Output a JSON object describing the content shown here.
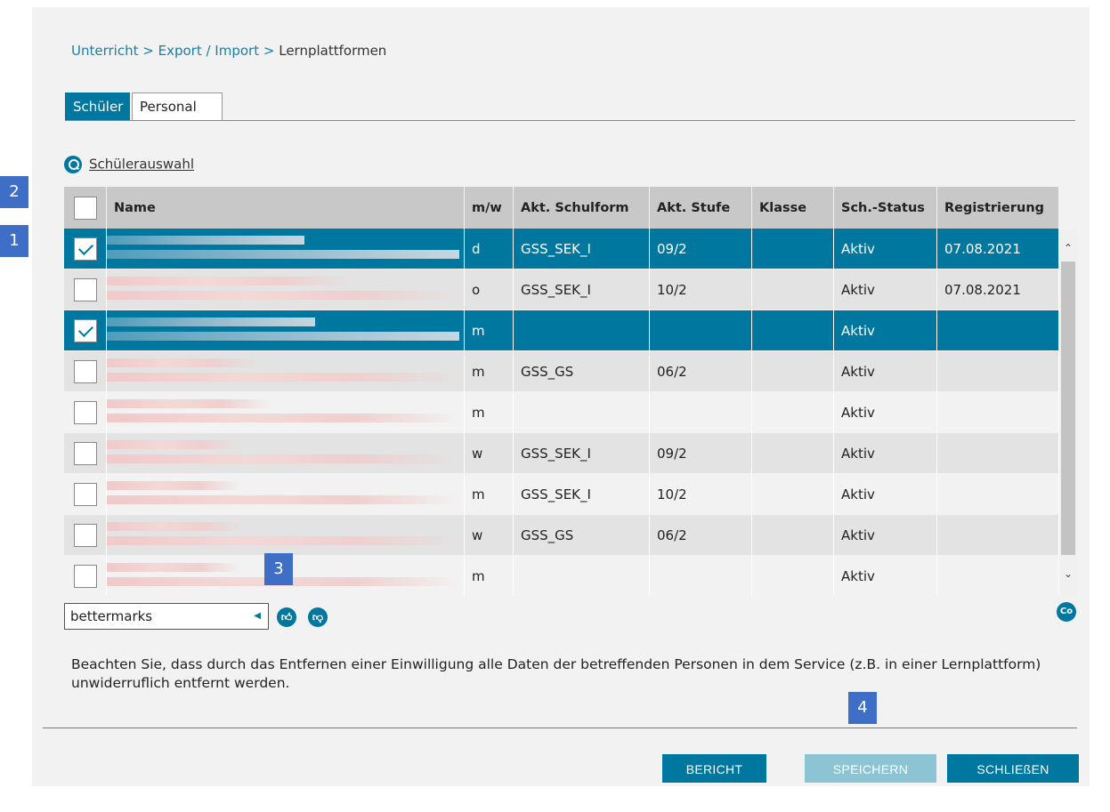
{
  "breadcrumb": {
    "item1": "Unterricht",
    "sep1": ">",
    "item2": "Export / Import",
    "sep2": ">",
    "current": "Lernplattformen"
  },
  "tabs": [
    {
      "label": "Schüler",
      "active": true
    },
    {
      "label": "Personal",
      "active": false
    }
  ],
  "selection_link": "Schülerauswahl",
  "annotations": [
    "1",
    "2",
    "3",
    "4"
  ],
  "table": {
    "columns": [
      "Name",
      "m/w",
      "Akt. Schulform",
      "Akt. Stufe",
      "Klasse",
      "Sch.-Status",
      "Registrierung"
    ],
    "rows": [
      {
        "checked": true,
        "selected": true,
        "mw": "d",
        "schulform": "GSS_SEK_I",
        "stufe": "09/2",
        "klasse": "",
        "status": "Aktiv",
        "registrierung": "07.08.2021"
      },
      {
        "checked": false,
        "selected": false,
        "mw": "o",
        "schulform": "GSS_SEK_I",
        "stufe": "10/2",
        "klasse": "",
        "status": "Aktiv",
        "registrierung": "07.08.2021"
      },
      {
        "checked": true,
        "selected": true,
        "mw": "m",
        "schulform": "",
        "stufe": "",
        "klasse": "",
        "status": "Aktiv",
        "registrierung": ""
      },
      {
        "checked": false,
        "selected": false,
        "mw": "m",
        "schulform": "GSS_GS",
        "stufe": "06/2",
        "klasse": "",
        "status": "Aktiv",
        "registrierung": ""
      },
      {
        "checked": false,
        "selected": false,
        "mw": "m",
        "schulform": "",
        "stufe": "",
        "klasse": "",
        "status": "Aktiv",
        "registrierung": ""
      },
      {
        "checked": false,
        "selected": false,
        "mw": "w",
        "schulform": "GSS_SEK_I",
        "stufe": "09/2",
        "klasse": "",
        "status": "Aktiv",
        "registrierung": ""
      },
      {
        "checked": false,
        "selected": false,
        "mw": "m",
        "schulform": "GSS_SEK_I",
        "stufe": "10/2",
        "klasse": "",
        "status": "Aktiv",
        "registrierung": ""
      },
      {
        "checked": false,
        "selected": false,
        "mw": "w",
        "schulform": "GSS_GS",
        "stufe": "06/2",
        "klasse": "",
        "status": "Aktiv",
        "registrierung": ""
      },
      {
        "checked": false,
        "selected": false,
        "mw": "m",
        "schulform": "",
        "stufe": "",
        "klasse": "",
        "status": "Aktiv",
        "registrierung": ""
      }
    ]
  },
  "service_select": {
    "value": "bettermarks"
  },
  "icons": {
    "consent_grant": "thumbs-up-icon",
    "consent_revoke": "thumbs-down-icon",
    "corner": "co-icon",
    "corner_text": "Co"
  },
  "notice": "Beachten Sie, dass durch das Entfernen einer Einwilligung alle Daten der betreffenden Personen in dem Service (z.B. in einer Lernplattform) unwiderruflich entfernt werden.",
  "buttons": {
    "report": "BERICHT",
    "save": "SPEICHERN",
    "close": "SCHLIEßEN"
  },
  "colors": {
    "accent": "#00779e",
    "disabled_button": "#8cc4d4",
    "annotation_badge": "#3f6ec6"
  }
}
